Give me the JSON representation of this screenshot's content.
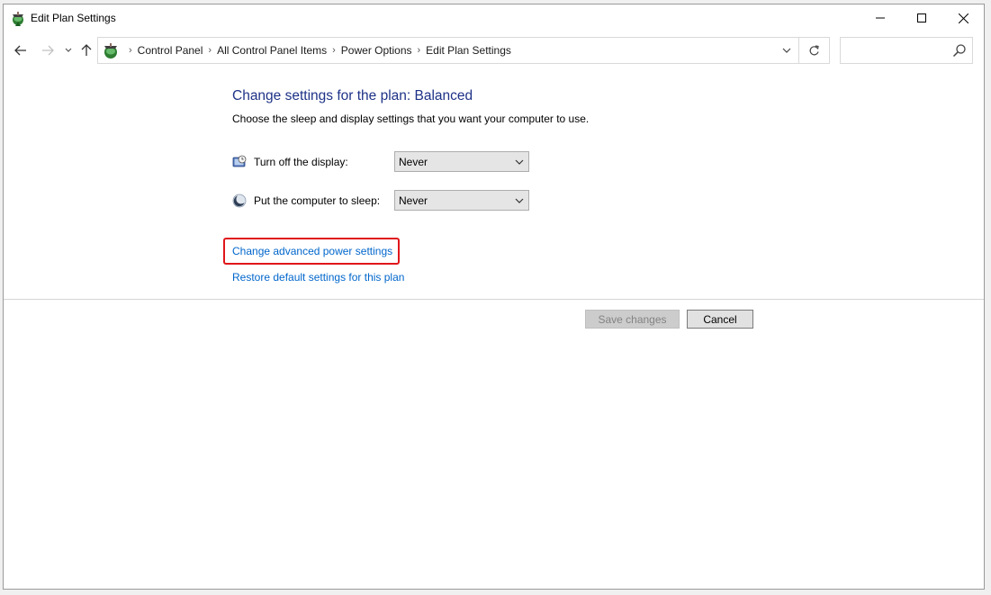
{
  "window": {
    "title": "Edit Plan Settings"
  },
  "address_bar": {
    "breadcrumbs": [
      "Control Panel",
      "All Control Panel Items",
      "Power Options",
      "Edit Plan Settings"
    ]
  },
  "search": {
    "placeholder": "",
    "value": ""
  },
  "content": {
    "heading": "Change settings for the plan: Balanced",
    "subtitle": "Choose the sleep and display settings that you want your computer to use.",
    "display_setting": {
      "label": "Turn off the display:",
      "value": "Never"
    },
    "sleep_setting": {
      "label": "Put the computer to sleep:",
      "value": "Never"
    },
    "advanced_link": "Change advanced power settings",
    "restore_link": "Restore default settings for this plan"
  },
  "buttons": {
    "save": "Save changes",
    "cancel": "Cancel"
  },
  "colors": {
    "heading": "#1e3287",
    "link": "#0066cc",
    "highlight": "#e0161a"
  }
}
